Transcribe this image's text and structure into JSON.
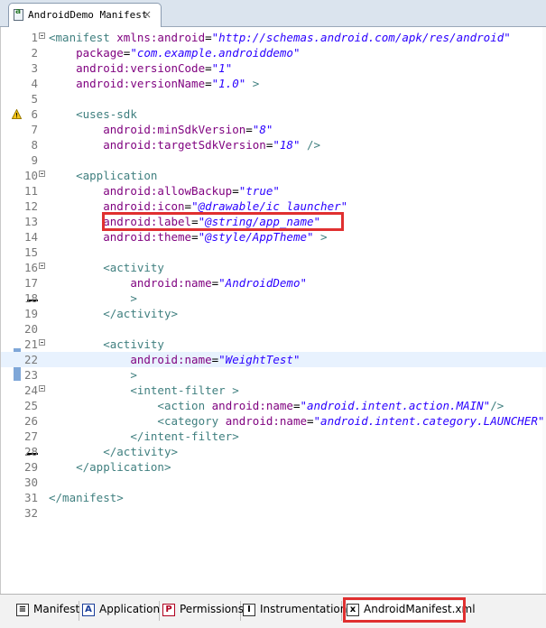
{
  "editor_tab": {
    "title": "AndroidDemo Manifest",
    "close_glyph": "×"
  },
  "code_lines": [
    {
      "n": "1",
      "fold": true,
      "segs": [
        [
          "t",
          "<manifest "
        ],
        [
          "a",
          "xmlns:android"
        ],
        [
          "p",
          "="
        ],
        [
          "v",
          "\"http://schemas.android.com/apk/res/android\""
        ]
      ]
    },
    {
      "n": "2",
      "segs": [
        [
          "p",
          "    "
        ],
        [
          "a",
          "package"
        ],
        [
          "p",
          "="
        ],
        [
          "v",
          "\"com.example.androiddemo\""
        ]
      ]
    },
    {
      "n": "3",
      "segs": [
        [
          "p",
          "    "
        ],
        [
          "a",
          "android:versionCode"
        ],
        [
          "p",
          "="
        ],
        [
          "v",
          "\"1\""
        ]
      ]
    },
    {
      "n": "4",
      "segs": [
        [
          "p",
          "    "
        ],
        [
          "a",
          "android:versionName"
        ],
        [
          "p",
          "="
        ],
        [
          "v",
          "\"1.0\""
        ],
        [
          "t",
          " >"
        ]
      ]
    },
    {
      "n": "5",
      "segs": []
    },
    {
      "n": "6",
      "warn": true,
      "segs": [
        [
          "p",
          "    "
        ],
        [
          "t",
          "<uses-sdk"
        ]
      ]
    },
    {
      "n": "7",
      "segs": [
        [
          "p",
          "        "
        ],
        [
          "a",
          "android:minSdkVersion"
        ],
        [
          "p",
          "="
        ],
        [
          "v",
          "\"8\""
        ]
      ]
    },
    {
      "n": "8",
      "segs": [
        [
          "p",
          "        "
        ],
        [
          "a",
          "android:targetSdkVersion"
        ],
        [
          "p",
          "="
        ],
        [
          "v",
          "\"18\""
        ],
        [
          "t",
          " />"
        ]
      ]
    },
    {
      "n": "9",
      "segs": []
    },
    {
      "n": "10",
      "fold": true,
      "segs": [
        [
          "p",
          "    "
        ],
        [
          "t",
          "<application"
        ]
      ]
    },
    {
      "n": "11",
      "segs": [
        [
          "p",
          "        "
        ],
        [
          "a",
          "android:allowBackup"
        ],
        [
          "p",
          "="
        ],
        [
          "v",
          "\"true\""
        ]
      ]
    },
    {
      "n": "12",
      "segs": [
        [
          "p",
          "        "
        ],
        [
          "a",
          "android:icon"
        ],
        [
          "p",
          "="
        ],
        [
          "v",
          "\"@drawable/ic_launcher\""
        ]
      ]
    },
    {
      "n": "13",
      "boxed": true,
      "segs": [
        [
          "p",
          "        "
        ],
        [
          "a",
          "android:label"
        ],
        [
          "p",
          "="
        ],
        [
          "v",
          "\"@string/app_name\""
        ]
      ]
    },
    {
      "n": "14",
      "segs": [
        [
          "p",
          "        "
        ],
        [
          "a",
          "android:theme"
        ],
        [
          "p",
          "="
        ],
        [
          "v",
          "\"@style/AppTheme\""
        ],
        [
          "t",
          " >"
        ]
      ]
    },
    {
      "n": "15",
      "segs": []
    },
    {
      "n": "16",
      "fold": true,
      "segs": [
        [
          "p",
          "        "
        ],
        [
          "t",
          "<activity"
        ]
      ]
    },
    {
      "n": "17",
      "segs": [
        [
          "p",
          "            "
        ],
        [
          "a",
          "android:name"
        ],
        [
          "p",
          "="
        ],
        [
          "v",
          "\"AndroidDemo\""
        ]
      ]
    },
    {
      "n": "18",
      "segs": [
        [
          "p",
          "            "
        ],
        [
          "t",
          ">"
        ]
      ]
    },
    {
      "n": "19",
      "segs": [
        [
          "p",
          "        "
        ],
        [
          "t",
          "</activity>"
        ]
      ]
    },
    {
      "n": "20",
      "segs": []
    },
    {
      "n": "21",
      "fold": true,
      "segs": [
        [
          "p",
          "        "
        ],
        [
          "t",
          "<activity"
        ]
      ]
    },
    {
      "n": "22",
      "current": true,
      "segs": [
        [
          "p",
          "            "
        ],
        [
          "a",
          "android:name"
        ],
        [
          "p",
          "="
        ],
        [
          "v",
          "\"WeightTest\""
        ]
      ]
    },
    {
      "n": "23",
      "segs": [
        [
          "p",
          "            "
        ],
        [
          "t",
          ">"
        ]
      ]
    },
    {
      "n": "24",
      "fold": true,
      "segs": [
        [
          "p",
          "            "
        ],
        [
          "t",
          "<intent-filter >"
        ]
      ]
    },
    {
      "n": "25",
      "segs": [
        [
          "p",
          "                "
        ],
        [
          "t",
          "<action "
        ],
        [
          "a",
          "android:name"
        ],
        [
          "p",
          "="
        ],
        [
          "v",
          "\"android.intent.action.MAIN\""
        ],
        [
          "t",
          "/>"
        ]
      ]
    },
    {
      "n": "26",
      "segs": [
        [
          "p",
          "                "
        ],
        [
          "t",
          "<category "
        ],
        [
          "a",
          "android:name"
        ],
        [
          "p",
          "="
        ],
        [
          "v",
          "\"android.intent.category.LAUNCHER\""
        ],
        [
          "t",
          " />"
        ]
      ]
    },
    {
      "n": "27",
      "segs": [
        [
          "p",
          "            "
        ],
        [
          "t",
          "</intent-filter>"
        ]
      ]
    },
    {
      "n": "28",
      "segs": [
        [
          "p",
          "        "
        ],
        [
          "t",
          "</activity>"
        ]
      ]
    },
    {
      "n": "29",
      "segs": [
        [
          "p",
          "    "
        ],
        [
          "t",
          "</application>"
        ]
      ]
    },
    {
      "n": "30",
      "segs": []
    },
    {
      "n": "31",
      "segs": [
        [
          "t",
          "</manifest>"
        ]
      ]
    },
    {
      "n": "32",
      "segs": []
    }
  ],
  "bottom_tabs": [
    {
      "icon": "≡",
      "label": "Manifest"
    },
    {
      "icon": "A",
      "label": "Application"
    },
    {
      "icon": "P",
      "label": "Permissions"
    },
    {
      "icon": "I",
      "label": "Instrumentation"
    },
    {
      "icon": "x",
      "label": "AndroidManifest.xml",
      "active": true
    }
  ],
  "colors": {
    "tag": "#3f7f7f",
    "attribute": "#7f007f",
    "value": "#2a00ff",
    "highlight_box": "#e03030"
  }
}
